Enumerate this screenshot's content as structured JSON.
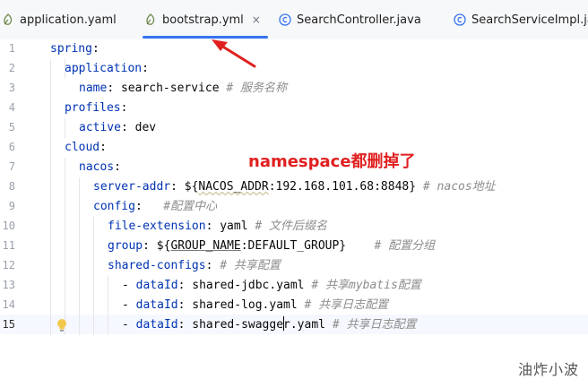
{
  "tabs": [
    {
      "label": "application.yaml",
      "icon": "yaml-file-icon",
      "active": false
    },
    {
      "label": "bootstrap.yml",
      "icon": "yaml-file-icon",
      "active": true,
      "close": "×"
    },
    {
      "label": "SearchController.java",
      "icon": "java-class-icon",
      "active": false
    },
    {
      "label": "SearchServiceImpl.java",
      "icon": "java-class-icon",
      "active": false
    }
  ],
  "line_numbers": [
    "1",
    "2",
    "3",
    "4",
    "5",
    "6",
    "7",
    "8",
    "9",
    "10",
    "11",
    "12",
    "13",
    "14",
    "15"
  ],
  "code": {
    "l1": {
      "key": "spring",
      "p": ":"
    },
    "l2": {
      "key": "application",
      "p": ":"
    },
    "l3": {
      "key": "name",
      "p": ": ",
      "val": "search-service",
      "comment": "# 服务名称"
    },
    "l4": {
      "key": "profiles",
      "p": ":"
    },
    "l5": {
      "key": "active",
      "p": ": ",
      "val": "dev"
    },
    "l6": {
      "key": "cloud",
      "p": ":"
    },
    "l7": {
      "key": "nacos",
      "p": ":"
    },
    "l8": {
      "key": "server-addr",
      "p": ": ",
      "pre": "${",
      "ref": "NACOS_ADDR",
      "post": ":192.168.101.68:8848}",
      "comment": "# nacos地址"
    },
    "l9": {
      "key": "config",
      "p": ":",
      "comment": "#配置中心"
    },
    "l10": {
      "key": "file-extension",
      "p": ": ",
      "val": "yaml",
      "comment": "# 文件后缀名"
    },
    "l11": {
      "key": "group",
      "p": ": ",
      "pre": "${",
      "ref": "GROUP_NAME",
      "post": ":DEFAULT_GROUP}",
      "comment": "# 配置分组"
    },
    "l12": {
      "key": "shared-configs",
      "p": ":",
      "comment": "# 共享配置"
    },
    "l13": {
      "dash": "- ",
      "key": "dataId",
      "p": ": ",
      "val": "shared-jdbc.yaml",
      "comment": "# 共享mybatis配置"
    },
    "l14": {
      "dash": "- ",
      "key": "dataId",
      "p": ": ",
      "val": "shared-log.yaml",
      "comment": "# 共享日志配置"
    },
    "l15": {
      "dash": "- ",
      "key": "dataId",
      "p": ": ",
      "val_a": "shared-swagge",
      "val_b": "r.yaml",
      "comment": "# 共享日志配置"
    }
  },
  "annotation": "namespace都删掉了",
  "watermark": "油炸小波",
  "colors": {
    "key": "#0033b3",
    "comment": "#8c8c8c",
    "accent": "#3574f0",
    "annotation": "#e02020"
  }
}
